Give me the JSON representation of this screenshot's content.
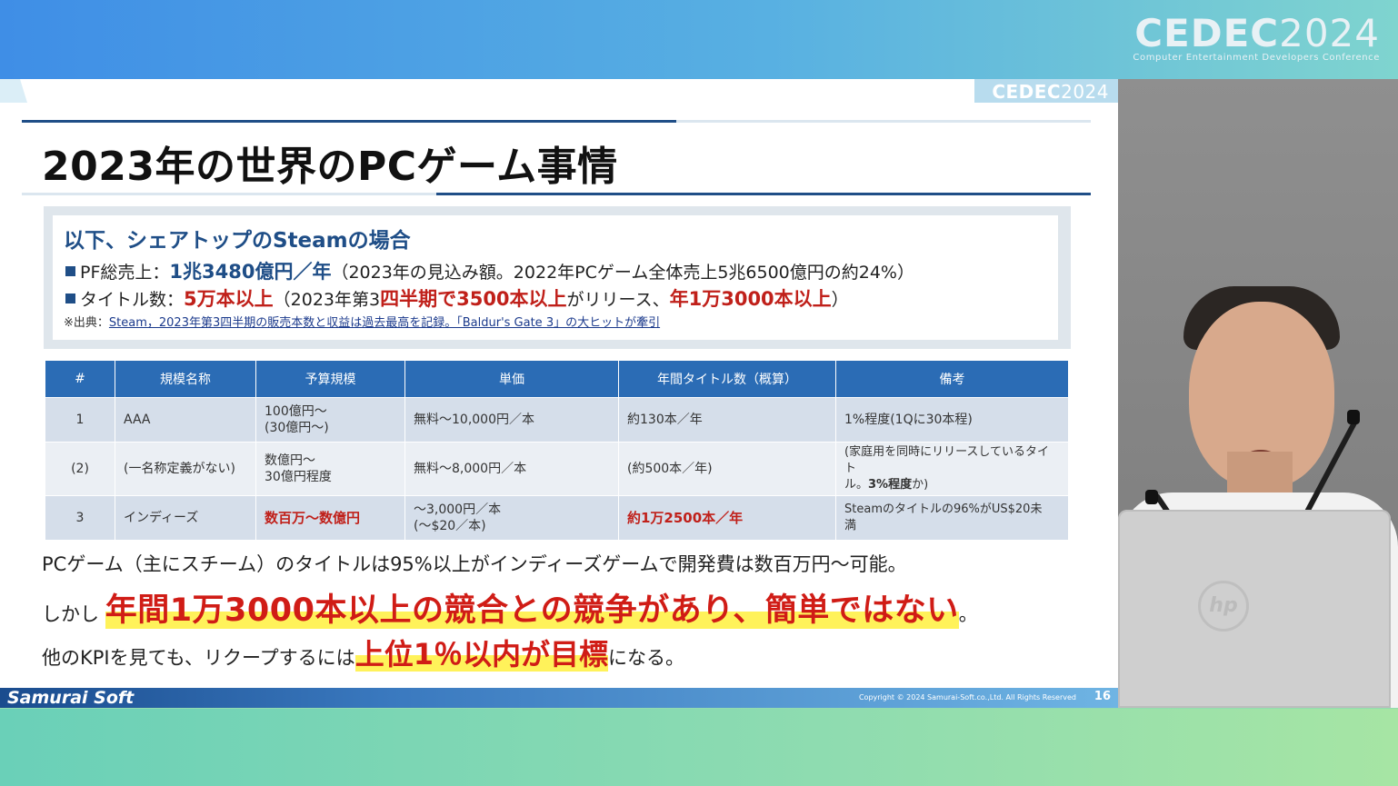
{
  "event": {
    "logo_main": "CEDEC",
    "logo_year": "2024",
    "logo_sub": "Computer Entertainment Developers Conference"
  },
  "slide": {
    "header_logo_main": "CEDEC",
    "header_logo_year": "2024",
    "title": "2023年の世界のPCゲーム事情",
    "steam_box": {
      "heading": "以下、シェアトップのSteamの場合",
      "line1": {
        "label": "PF総売上：",
        "value": "1兆3480億円／年",
        "note": "（2023年の見込み額。2022年PCゲーム全体売上5兆6500億円の約24%）"
      },
      "line2": {
        "label": "タイトル数：",
        "value": "5万本以上",
        "note_a": "（2023年第3",
        "highlight_a": "四半期で3500本以上",
        "note_b": "がリリース、",
        "highlight_b": "年1万3000本以上",
        "note_c": "）"
      },
      "source_prefix": "※出典：",
      "source_link": "Steam，2023年第3四半期の販売本数と収益は過去最高を記録。「Baldur's Gate 3」の大ヒットが牽引"
    },
    "table": {
      "headers": [
        "#",
        "規模名称",
        "予算規模",
        "単価",
        "年間タイトル数（概算）",
        "備考"
      ],
      "rows": [
        {
          "num": "1",
          "name": "AAA",
          "budget_1": "100億円～",
          "budget_2": "(30億円～)",
          "price_1": "無料～10,000円／本",
          "price_2": "",
          "titles": "約130本／年",
          "notes_1": "1%程度(1Qに30本程)",
          "notes_2": ""
        },
        {
          "num": "(2)",
          "name": "(一名称定義がない)",
          "budget_1": "数億円～",
          "budget_2": "30億円程度",
          "price_1": "無料～8,000円／本",
          "price_2": "",
          "titles": "(約500本／年)",
          "notes_1": "(家庭用を同時にリリースしているタイト",
          "notes_2a": "ル。",
          "notes_2b": "3%程度",
          "notes_2c": "か)"
        },
        {
          "num": "3",
          "name": "インディーズ",
          "budget_1": "数百万～数億円",
          "budget_2": "",
          "price_1": "～3,000円／本",
          "price_2": "(～$20／本)",
          "titles": "約1万2500本／年",
          "notes_1": "Steamのタイトルの96%がUS$20未",
          "notes_2": "満"
        }
      ]
    },
    "summary": {
      "line1": "PCゲーム（主にスチーム）のタイトルは95%以上がインディーズゲームで開発費は数百万円～可能。",
      "line2_prefix": "しかし",
      "line2_highlight": "年間1万3000本以上の競合との競争があり、簡単ではない",
      "line2_suffix": "。",
      "line3_prefix": "他のKPIを見ても、リクープするには",
      "line3_highlight": "上位1％以内が目標",
      "line3_suffix": "になる。"
    },
    "footer": {
      "brand": "Samurai Soft",
      "copyright": "Copyright © 2024 Samurai-Soft.co.,Ltd. All Rights Reserved",
      "page": "16"
    }
  },
  "speaker_panel": {
    "laptop_logo": "hp"
  },
  "colors": {
    "accent_blue": "#1f4e87",
    "table_header": "#2b6cb5",
    "highlight_red": "#c0201a",
    "highlight_yellow": "#fff25a"
  }
}
